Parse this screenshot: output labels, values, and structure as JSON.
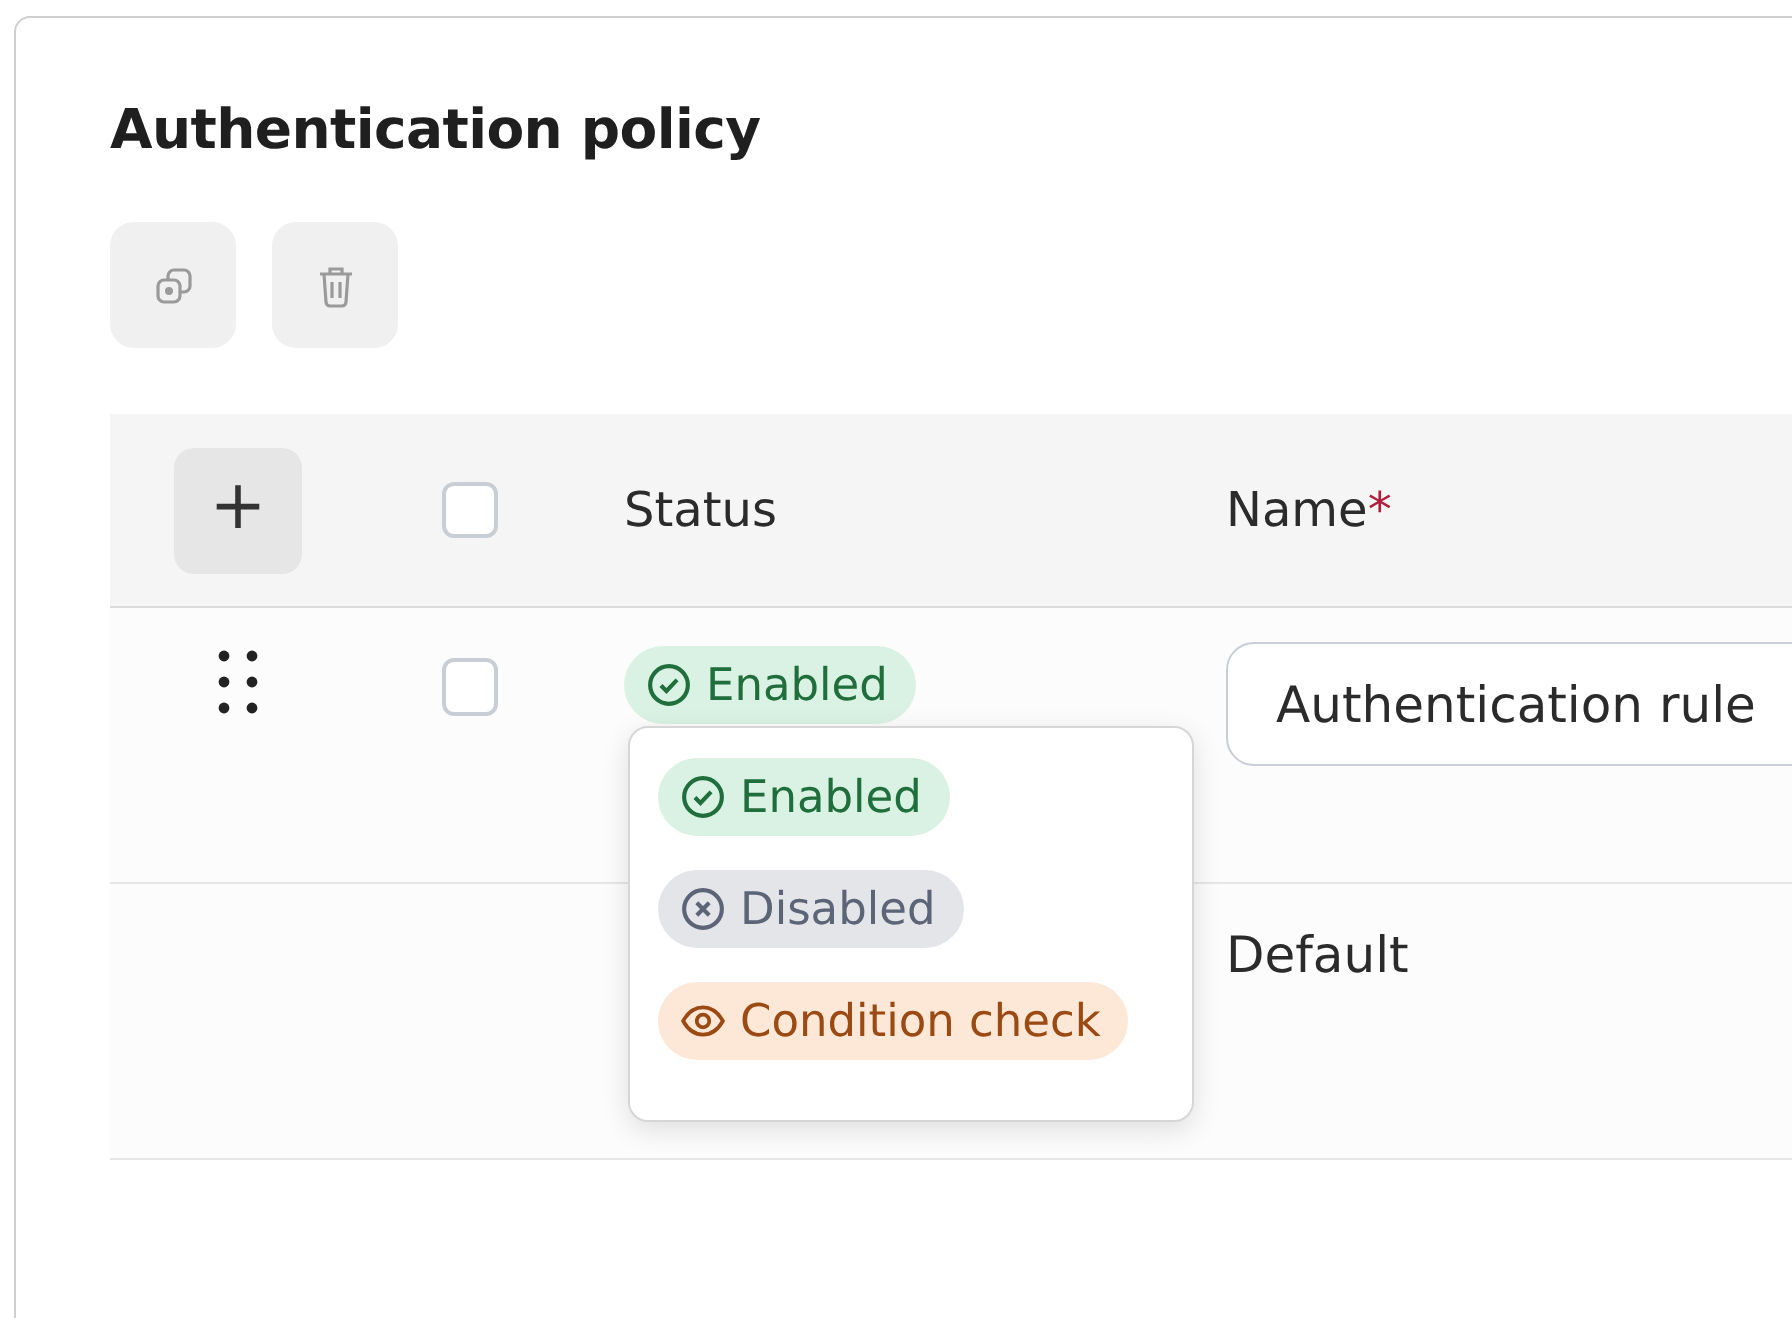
{
  "panel": {
    "title": "Authentication policy"
  },
  "toolbar": [
    {
      "kind": "duplicate",
      "disabled": true
    },
    {
      "kind": "delete",
      "disabled": true
    }
  ],
  "table": {
    "add_button": {
      "label": "+"
    },
    "header_checkbox": {
      "checked": false
    },
    "columns": [
      {
        "label": "Status"
      },
      {
        "label": "Name",
        "required_mark": "*"
      }
    ],
    "rows": [
      {
        "draggable": true,
        "checkbox": {
          "checked": false
        },
        "status": {
          "label": "Enabled",
          "kind": "enabled",
          "open": true,
          "options": [
            {
              "label": "Enabled",
              "kind": "enabled"
            },
            {
              "label": "Disabled",
              "kind": "disabled"
            },
            {
              "label": "Condition check",
              "kind": "condition"
            }
          ]
        },
        "name": {
          "kind": "input",
          "value": "Authentication rule"
        }
      },
      {
        "draggable": false,
        "name": {
          "kind": "text",
          "value": "Default"
        }
      }
    ]
  }
}
